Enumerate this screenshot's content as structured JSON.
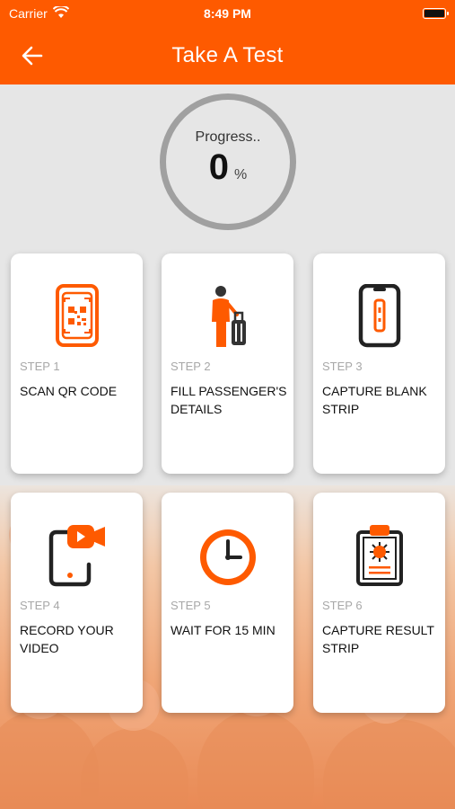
{
  "status_bar": {
    "carrier": "Carrier",
    "time": "8:49 PM"
  },
  "header": {
    "title": "Take A Test"
  },
  "progress": {
    "label": "Progress..",
    "value": "0",
    "unit": "%"
  },
  "steps": [
    {
      "step": "STEP 1",
      "title": "SCAN QR CODE",
      "icon": "qr-phone-icon"
    },
    {
      "step": "STEP 2",
      "title": "FILL PASSENGER'S DETAILS",
      "icon": "passenger-luggage-icon"
    },
    {
      "step": "STEP 3",
      "title": "CAPTURE BLANK STRIP",
      "icon": "phone-strip-icon"
    },
    {
      "step": "STEP 4",
      "title": "RECORD YOUR VIDEO",
      "icon": "video-record-icon"
    },
    {
      "step": "STEP 5",
      "title": "WAIT FOR 15 MIN",
      "icon": "clock-icon"
    },
    {
      "step": "STEP 6",
      "title": "CAPTURE RESULT STRIP",
      "icon": "clipboard-virus-icon"
    }
  ],
  "colors": {
    "accent": "#fe5a00",
    "background": "#e6e6e6",
    "ring": "#a0a0a0"
  }
}
